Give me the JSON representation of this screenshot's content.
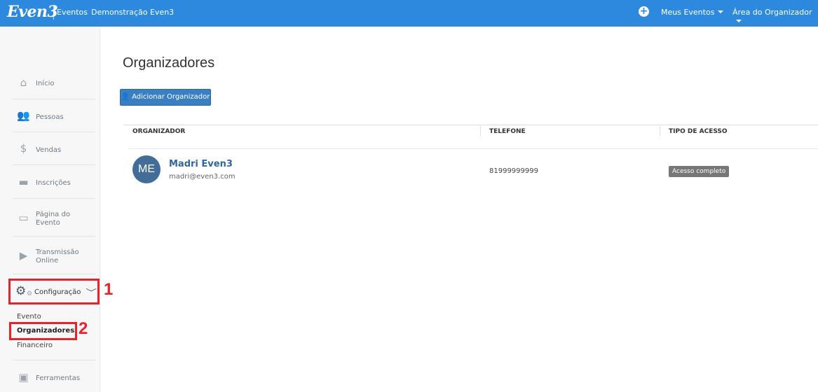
{
  "topbar": {
    "logo": "Even3",
    "nav_eventos": "Eventos",
    "event_name": "Demonstração Even3",
    "plus": "+",
    "meus_eventos": "Meus Eventos",
    "area_organizador": "Área do Organizador"
  },
  "sidebar": {
    "items": [
      {
        "label": "Início",
        "icon": "home-icon"
      },
      {
        "label": "Pessoas",
        "icon": "people-icon"
      },
      {
        "label": "Vendas",
        "icon": "money-bag-icon"
      },
      {
        "label": "Inscrições",
        "icon": "ticket-icon"
      },
      {
        "label_line1": "Página do",
        "label_line2": "Evento",
        "icon": "browser-window-icon"
      },
      {
        "label_line1": "Transmissão",
        "label_line2": "Online",
        "icon": "play-icon"
      }
    ],
    "config": {
      "label": "Configuração",
      "icon": "gear-icon",
      "chevron": "﹀"
    },
    "submenu": {
      "evento": "Evento",
      "organizadores": "Organizadores",
      "financeiro": "Financeiro"
    },
    "ferramentas": {
      "label": "Ferramentas",
      "icon": "toolbox-icon"
    }
  },
  "annotations": {
    "n1": "1",
    "n2": "2"
  },
  "main": {
    "title": "Organizadores",
    "add_button": "Adicionar Organizador",
    "columns": {
      "organizador": "ORGANIZADOR",
      "telefone": "TELEFONE",
      "tipo": "TIPO DE ACESSO"
    },
    "rows": [
      {
        "initials": "ME",
        "name": "Madri Even3",
        "email": "madri@even3.com",
        "phone": "81999999999",
        "access": "Acesso completo"
      }
    ]
  },
  "colors": {
    "brand": "#2d89de",
    "highlight": "#e8222a",
    "avatar": "#426d99"
  }
}
